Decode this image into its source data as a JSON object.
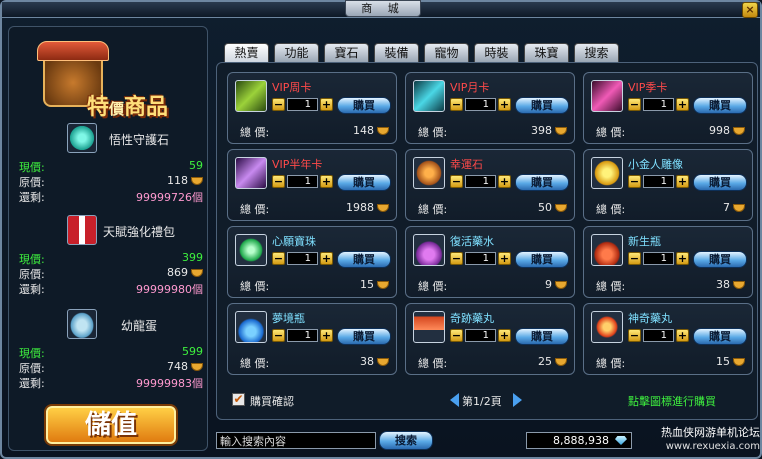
{
  "title": "商 城",
  "close_label": "×",
  "left": {
    "logo_text_a": "特",
    "logo_text_small": "價",
    "logo_text_b": "商品",
    "specials": [
      {
        "name": "悟性守護石",
        "icon": "green-orb-icon",
        "now_label": "現價:",
        "now_value": "59",
        "orig_label": "原價:",
        "orig_value": "118",
        "remain_label": "還剩:",
        "remain_value": "99999726個"
      },
      {
        "name": "天賦強化禮包",
        "icon": "gift-box-icon",
        "now_label": "現價:",
        "now_value": "399",
        "orig_label": "原價:",
        "orig_value": "869",
        "remain_label": "還剩:",
        "remain_value": "99999980個"
      },
      {
        "name": "幼龍蛋",
        "icon": "dragon-egg-icon",
        "now_label": "現價:",
        "now_value": "599",
        "orig_label": "原價:",
        "orig_value": "748",
        "remain_label": "還剩:",
        "remain_value": "99999983個"
      }
    ],
    "deposit_label": "儲值"
  },
  "tabs": [
    "熱賣",
    "功能",
    "寶石",
    "裝備",
    "寵物",
    "時裝",
    "珠寶",
    "搜索"
  ],
  "items": [
    {
      "name": "VIP周卡",
      "color": "red",
      "icon": "vip-card-green-icon",
      "qty": "1",
      "buy": "購買",
      "total_label": "總 價:",
      "total": "148"
    },
    {
      "name": "VIP月卡",
      "color": "red",
      "icon": "vip-card-cyan-icon",
      "qty": "1",
      "buy": "購買",
      "total_label": "總 價:",
      "total": "398"
    },
    {
      "name": "VIP季卡",
      "color": "red",
      "icon": "vip-card-pink-icon",
      "qty": "1",
      "buy": "購買",
      "total_label": "總 價:",
      "total": "998"
    },
    {
      "name": "VIP半年卡",
      "color": "red",
      "icon": "vip-card-purple-icon",
      "qty": "1",
      "buy": "購買",
      "total_label": "總 價:",
      "total": "1988"
    },
    {
      "name": "幸運石",
      "color": "red",
      "icon": "lucky-stone-icon",
      "qty": "1",
      "buy": "購買",
      "total_label": "總 價:",
      "total": "50"
    },
    {
      "name": "小金人雕像",
      "color": "cyan",
      "icon": "gold-statue-icon",
      "qty": "1",
      "buy": "購買",
      "total_label": "總 價:",
      "total": "7"
    },
    {
      "name": "心願寶珠",
      "color": "cyan",
      "icon": "wish-orb-icon",
      "qty": "1",
      "buy": "購買",
      "total_label": "總 價:",
      "total": "15"
    },
    {
      "name": "復活藥水",
      "color": "cyan",
      "icon": "revive-potion-icon",
      "qty": "1",
      "buy": "購買",
      "total_label": "總 價:",
      "total": "9"
    },
    {
      "name": "新生瓶",
      "color": "cyan",
      "icon": "rebirth-bottle-icon",
      "qty": "1",
      "buy": "購買",
      "total_label": "總 價:",
      "total": "38"
    },
    {
      "name": "夢境瓶",
      "color": "cyan",
      "icon": "dream-bottle-icon",
      "qty": "1",
      "buy": "購買",
      "total_label": "總 價:",
      "total": "38"
    },
    {
      "name": "奇跡藥丸",
      "color": "cyan",
      "icon": "miracle-pill-icon",
      "qty": "1",
      "buy": "購買",
      "total_label": "總 價:",
      "total": "25"
    },
    {
      "name": "神奇藥丸",
      "color": "cyan",
      "icon": "magic-pill-icon",
      "qty": "1",
      "buy": "購買",
      "total_label": "總 價:",
      "total": "15"
    }
  ],
  "confirm_label": "購買確認",
  "page_text": "第1/2頁",
  "hint": "點擊圖標進行購買",
  "search": {
    "placeholder": "輸入搜索內容",
    "button": "搜索"
  },
  "balance": "8,888,938",
  "watermark": {
    "line1": "热血侠网游单机论坛",
    "line2": "www.rexuexia.com"
  },
  "colors": {
    "price_green": "#3ef03e",
    "remain_pink": "#ff9ad0",
    "name_red": "#ff4a4a",
    "name_cyan": "#7fe0ff"
  }
}
